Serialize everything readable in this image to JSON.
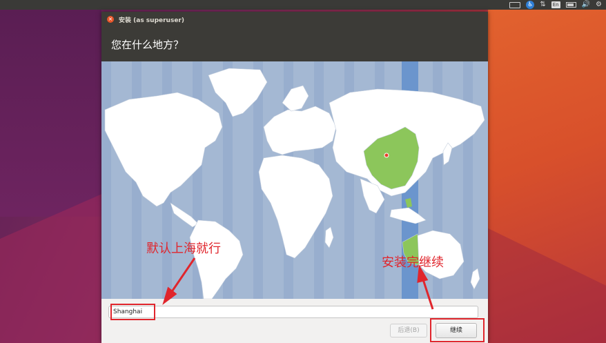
{
  "topbar": {
    "icons": [
      "keyboard-icon",
      "accessibility-icon",
      "network-icon",
      "input-method-icon",
      "battery-icon",
      "volume-icon",
      "settings-icon"
    ],
    "input_method": "En",
    "access_glyph": "♿",
    "network_glyph": "⇅",
    "volume_glyph": "🔊",
    "settings_glyph": "⚙"
  },
  "window": {
    "title": "安装 (as superuser)",
    "close_glyph": "×",
    "header": "您在什么地方？"
  },
  "map": {
    "selected_city": "Shanghai",
    "highlight_color": "#8cc65b",
    "ocean_color": "#a4b8d3",
    "land_color": "#ffffff",
    "selected_band_color": "#6b95cd"
  },
  "timezone": {
    "value": "Shanghai"
  },
  "buttons": {
    "back": "后退(B)",
    "continue": "继续"
  },
  "annotations": {
    "left": "默认上海就行",
    "right": "安装完继续",
    "color": "#e0252c"
  }
}
